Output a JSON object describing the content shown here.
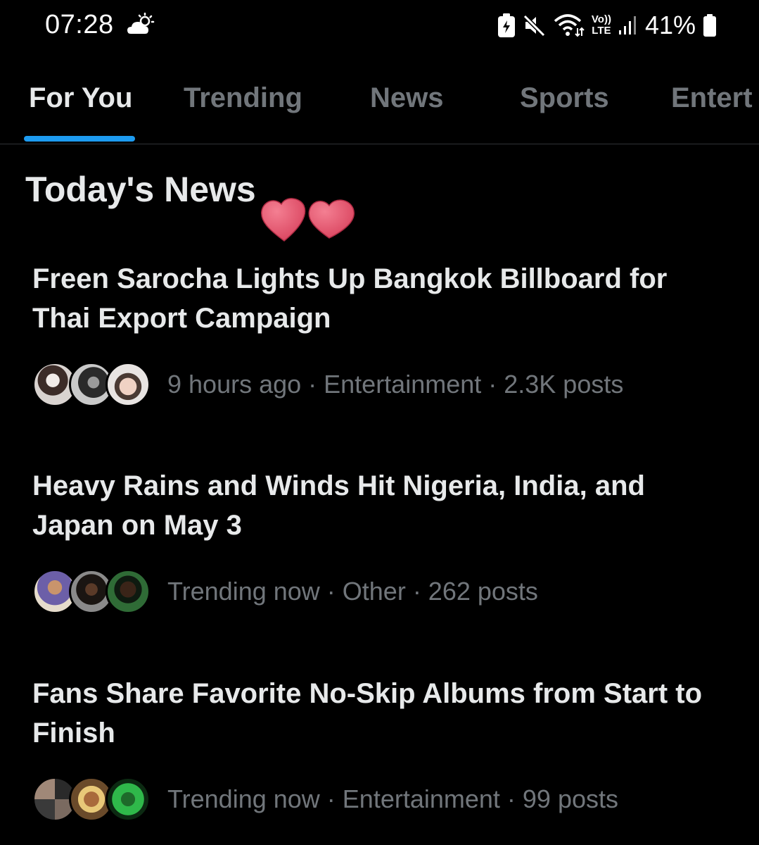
{
  "status_bar": {
    "time": "07:28",
    "battery_percent": "41%",
    "icons": [
      "partly-cloudy-icon",
      "battery-saver-icon",
      "mute-icon",
      "wifi-icon",
      "volte-icon",
      "signal-icon",
      "battery-icon"
    ],
    "volte_label_top": "Vo))",
    "volte_label_bottom": "LTE"
  },
  "tabs": [
    {
      "label": "For You",
      "active": true
    },
    {
      "label": "Trending",
      "active": false
    },
    {
      "label": "News",
      "active": false
    },
    {
      "label": "Sports",
      "active": false
    },
    {
      "label": "Entert",
      "active": false
    }
  ],
  "section": {
    "title": "Today's News"
  },
  "news": [
    {
      "headline": "Freen Sarocha Lights Up Bangkok Billboard for Thai Export Campaign",
      "meta": "9 hours ago · Entertainment · 2.3K posts"
    },
    {
      "headline": "Heavy Rains and Winds Hit Nigeria, India, and Japan on May 3",
      "meta": "Trending now · Other · 262 posts"
    },
    {
      "headline": "Fans Share Favorite No-Skip Albums from Start to Finish",
      "meta": "Trending now · Entertainment · 99 posts"
    }
  ],
  "colors": {
    "background": "#000000",
    "accent": "#1d9bf0",
    "text_primary": "#e7e9ea",
    "text_secondary": "#71767b",
    "heart": "#e8546e"
  }
}
